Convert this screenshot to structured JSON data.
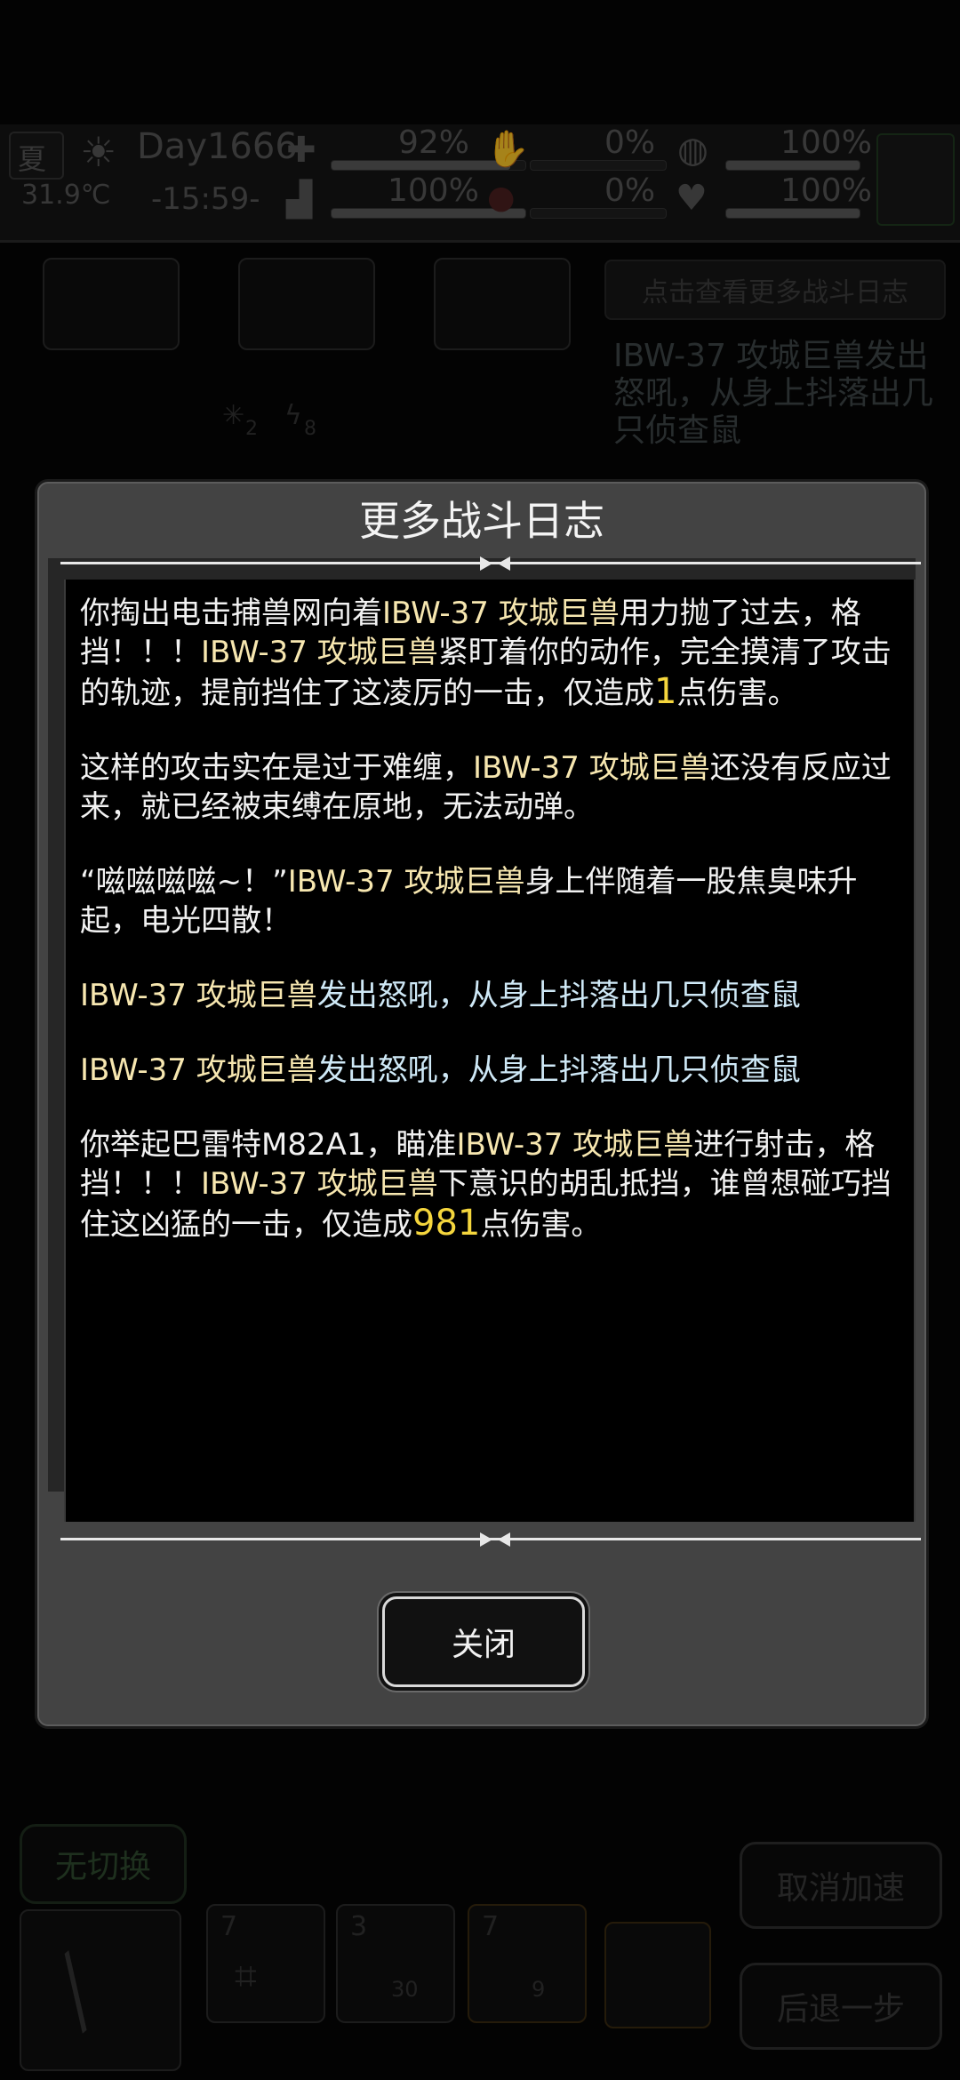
{
  "status": {
    "season": "夏",
    "temperature": "31.9℃",
    "day": "Day1666",
    "time": "-15:59-",
    "stats": [
      {
        "value": "92%"
      },
      {
        "value": "100%"
      },
      {
        "value": "0%"
      },
      {
        "value": "0%"
      },
      {
        "value": "100%"
      },
      {
        "value": "100%"
      }
    ]
  },
  "background": {
    "log_header_button": "点击查看更多战斗日志",
    "log_preview": "IBW-37 攻城巨兽发出怒吼，从身上抖落出几只侦查鼠",
    "no_switch_button": "无切换",
    "cancel_speed_button": "取消加速",
    "step_back_button": "后退一步",
    "slot_counts": [
      "7",
      "3",
      "7"
    ],
    "ammo_counts": [
      "30",
      "9"
    ],
    "status_counts": [
      "2",
      "8"
    ]
  },
  "dialog": {
    "title": "更多战斗日志",
    "close_label": "关闭",
    "entries": [
      {
        "parts": [
          {
            "t": "你掏出电击捕兽网向着",
            "c": ""
          },
          {
            "t": "IBW-37 攻城巨兽",
            "c": "hl"
          },
          {
            "t": "用力抛了过去，格挡！！！",
            "c": ""
          },
          {
            "t": "IBW-37 攻城巨兽",
            "c": "hl"
          },
          {
            "t": "紧盯着你的动作，完全摸清了攻击的轨迹，提前挡住了这凌厉的一击，仅造成",
            "c": ""
          },
          {
            "t": "1",
            "c": "num"
          },
          {
            "t": "点伤害。",
            "c": ""
          }
        ]
      },
      {
        "parts": [
          {
            "t": "这样的攻击实在是过于难缠，",
            "c": ""
          },
          {
            "t": "IBW-37 攻城巨兽",
            "c": "hl"
          },
          {
            "t": "还没有反应过来，就已经被束缚在原地，无法动弹。",
            "c": ""
          }
        ]
      },
      {
        "parts": [
          {
            "t": "“嗞嗞嗞嗞~！”",
            "c": ""
          },
          {
            "t": "IBW-37 攻城巨兽",
            "c": "hl"
          },
          {
            "t": "身上伴随着一股焦臭味升起，电光四散！",
            "c": ""
          }
        ]
      },
      {
        "cls": "cyan",
        "parts": [
          {
            "t": "IBW-37 攻城巨兽",
            "c": "hl"
          },
          {
            "t": "发出怒吼，从身上抖落出几只侦查鼠",
            "c": ""
          }
        ]
      },
      {
        "cls": "cyan",
        "parts": [
          {
            "t": "IBW-37 攻城巨兽",
            "c": "hl"
          },
          {
            "t": "发出怒吼，从身上抖落出几只侦查鼠",
            "c": ""
          }
        ]
      },
      {
        "parts": [
          {
            "t": "你举起巴雷特M82A1，瞄准",
            "c": ""
          },
          {
            "t": "IBW-37 攻城巨兽",
            "c": "hl"
          },
          {
            "t": "进行射击，格挡！！！",
            "c": ""
          },
          {
            "t": "IBW-37 攻城巨兽",
            "c": "hl"
          },
          {
            "t": "下意识的胡乱抵挡，谁曾想碰巧挡住这凶猛的一击，仅造成",
            "c": ""
          },
          {
            "t": "981",
            "c": "num"
          },
          {
            "t": "点伤害。",
            "c": ""
          }
        ]
      }
    ]
  },
  "colors": {
    "highlight": "#f7e7b0",
    "damage": "#f5d63d",
    "dialog_bg": "#434343"
  }
}
